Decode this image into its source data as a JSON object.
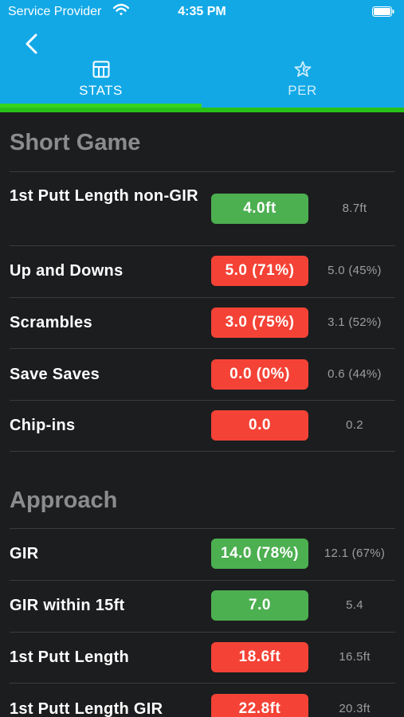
{
  "status": {
    "carrier": "Service Provider",
    "time": "4:35 PM",
    "icons": [
      "wifi-icon",
      "battery-icon"
    ]
  },
  "nav": {
    "back_icon": "chevron-left-icon",
    "tabs": [
      {
        "label": "STATS",
        "icon": "table-icon",
        "selected": true
      },
      {
        "label": "PER",
        "icon": "star-icon",
        "selected": false
      }
    ],
    "colors": {
      "header": "#12a8e6",
      "indicator": "#36d41f"
    }
  },
  "sections": [
    {
      "title": "Short Game",
      "rows": [
        {
          "label": "1st Putt Length non-GIR",
          "value": "4.0ft",
          "avg": "8.7ft",
          "status": "green"
        },
        {
          "label": "Up and Downs",
          "value": "5.0 (71%)",
          "avg": "5.0 (45%)",
          "status": "red"
        },
        {
          "label": "Scrambles",
          "value": "3.0 (75%)",
          "avg": "3.1 (52%)",
          "status": "red"
        },
        {
          "label": "Save Saves",
          "value": "0.0 (0%)",
          "avg": "0.6 (44%)",
          "status": "red"
        },
        {
          "label": "Chip-ins",
          "value": "0.0",
          "avg": "0.2",
          "status": "red"
        }
      ]
    },
    {
      "title": "Approach",
      "rows": [
        {
          "label": "GIR",
          "value": "14.0 (78%)",
          "avg": "12.1 (67%)",
          "status": "green"
        },
        {
          "label": "GIR within 15ft",
          "value": "7.0",
          "avg": "5.4",
          "status": "green"
        },
        {
          "label": "1st Putt Length",
          "value": "18.6ft",
          "avg": "16.5ft",
          "status": "red"
        },
        {
          "label": "1st Putt Length GIR",
          "value": "22.8ft",
          "avg": "20.3ft",
          "status": "red"
        }
      ]
    }
  ]
}
